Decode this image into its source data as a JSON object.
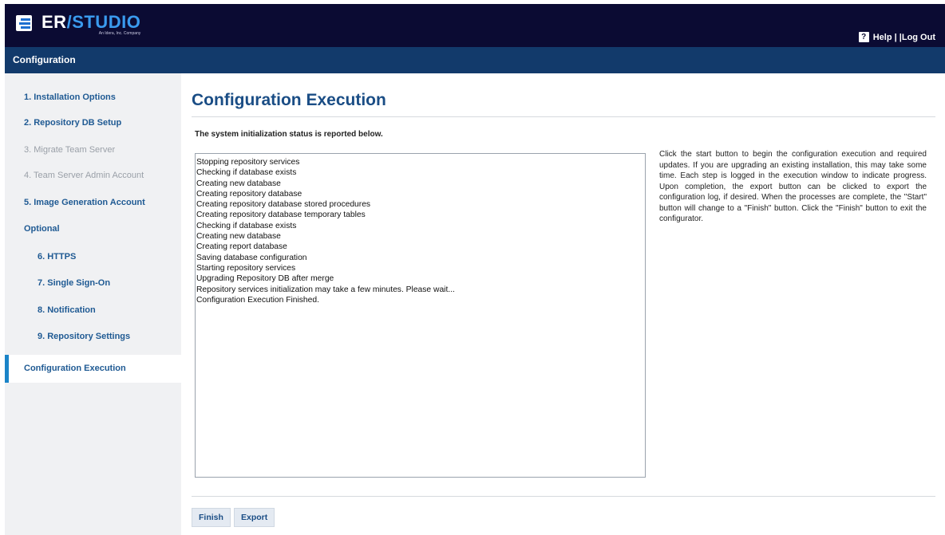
{
  "header": {
    "logo": {
      "er": "ER",
      "slash": "/",
      "studio": "STUDIO",
      "sub": "An Idera, Inc. Company"
    },
    "help_icon": "?",
    "help_label": "Help",
    "separator": "| |",
    "logout_label": "Log Out"
  },
  "config_bar": {
    "title": "Configuration"
  },
  "sidebar": {
    "items": [
      {
        "label": "1. Installation Options",
        "state": "enabled"
      },
      {
        "label": "2. Repository DB Setup",
        "state": "enabled"
      },
      {
        "label": "3. Migrate Team Server",
        "state": "disabled"
      },
      {
        "label": "4. Team Server Admin Account",
        "state": "disabled"
      },
      {
        "label": "5. Image Generation Account",
        "state": "enabled"
      },
      {
        "label": "Optional",
        "state": "enabled"
      },
      {
        "label": "6. HTTPS",
        "state": "enabled"
      },
      {
        "label": "7. Single Sign-On",
        "state": "enabled"
      },
      {
        "label": "8. Notification",
        "state": "enabled"
      },
      {
        "label": "9. Repository Settings",
        "state": "enabled"
      },
      {
        "label": "Configuration Execution",
        "state": "active"
      }
    ]
  },
  "main": {
    "title": "Configuration Execution",
    "status_note": "The system initialization status is reported below.",
    "log_lines": [
      "Stopping repository services",
      "Checking if database exists",
      "Creating new database",
      "Creating repository database",
      "Creating repository database stored procedures",
      "Creating repository database temporary tables",
      "Checking if database exists",
      "Creating new database",
      "Creating report database",
      "Saving database configuration",
      "Starting repository services",
      "Upgrading Repository DB after merge",
      "Repository services initialization may take a few minutes. Please wait...",
      "Configuration Execution Finished."
    ],
    "help_text": "Click the start button to begin the configuration execution and required updates. If you are upgrading an existing installation, this may take some time. Each step is logged in the execution window to indicate progress. Upon completion, the export button can be clicked to export the configuration log, if desired. When the processes are complete, the \"Start\" button will change to a \"Finish\" button. Click the \"Finish\" button to exit the configurator.",
    "buttons": {
      "finish": "Finish",
      "export": "Export"
    }
  },
  "colors": {
    "header_bg": "#0b0b33",
    "config_bar_bg": "#123a6b",
    "accent": "#1a84c8",
    "title": "#1a4d85"
  }
}
